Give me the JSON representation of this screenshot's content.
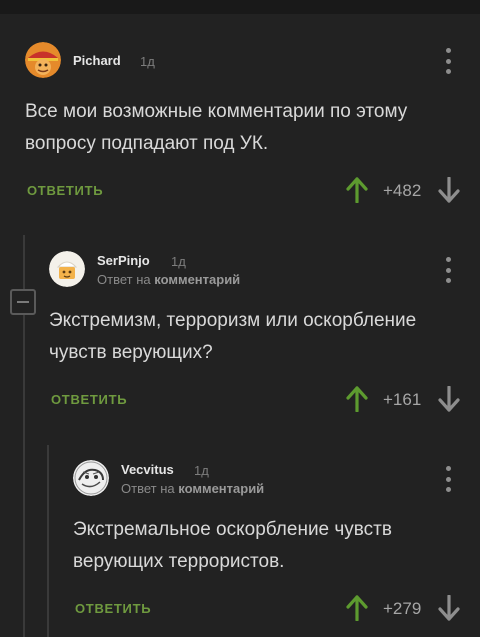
{
  "comments": [
    {
      "username": "Pichard",
      "time": "1д",
      "text": "Все мои возможные комментарии  по этому\nвопросу подпадают под УК.",
      "reply_label": "ОТВЕТИТЬ",
      "rating": "+482"
    },
    {
      "username": "SerPinjo",
      "time": "1д",
      "reply_to_prefix": "Ответ на",
      "reply_to_target": "комментарий",
      "text": "Экстремизм, терроризм или оскорбление\nчувств верующих?",
      "reply_label": "ОТВЕТИТЬ",
      "rating": "+161"
    },
    {
      "username": "Vecvitus",
      "time": "1д",
      "reply_to_prefix": "Ответ на",
      "reply_to_target": "комментарий",
      "text": "Экстремальное оскорбление чувств\nверующих террористов.",
      "reply_label": "ОТВЕТИТЬ",
      "rating": "+279"
    }
  ],
  "icons": {
    "upvote": "arrow-up-icon",
    "downvote": "arrow-down-icon",
    "menu": "more-vertical-icon",
    "collapse": "minus-square-icon"
  },
  "colors": {
    "background": "#222222",
    "upvote": "#5d9b2f",
    "reply": "#6f9a3f",
    "text": "#d9d9d9"
  }
}
